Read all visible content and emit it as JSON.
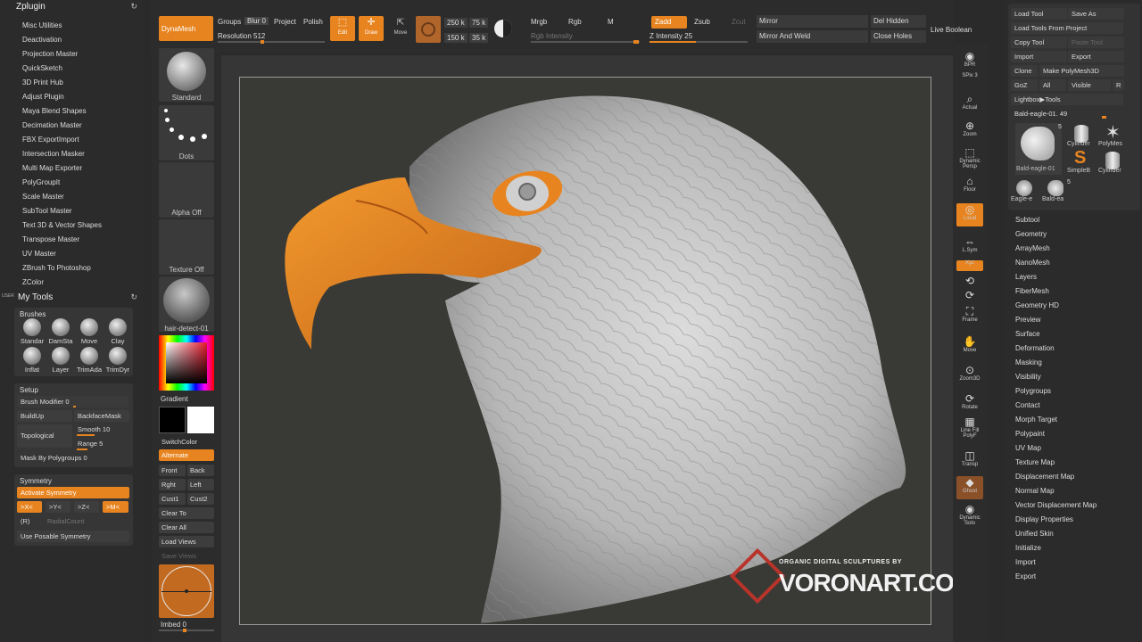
{
  "zplugin": {
    "title": "Zplugin",
    "items": [
      "Misc Utilities",
      "Deactivation",
      "Projection Master",
      "QuickSketch",
      "3D Print Hub",
      "Adjust Plugin",
      "Maya Blend Shapes",
      "Decimation Master",
      "FBX ExportImport",
      "Intersection Masker",
      "Multi Map Exporter",
      "PolyGroupIt",
      "Scale Master",
      "SubTool Master",
      "Text 3D & Vector Shapes",
      "Transpose Master",
      "UV Master",
      "ZBrush To Photoshop",
      "ZColor"
    ]
  },
  "mytools": {
    "user_tag": "USER",
    "title": "My Tools",
    "brushes_title": "Brushes",
    "brushes": [
      "Standar",
      "DamSta",
      "Move",
      "Clay",
      "Inflat",
      "Layer",
      "TrimAda",
      "TrimDyr"
    ],
    "setup_title": "Setup",
    "brush_modifier": "Brush Modifier 0",
    "buildup": "BuildUp",
    "backface": "BackfaceMask",
    "topological": "Topological",
    "smooth": "Smooth 10",
    "range": "Range 5",
    "mask_polygroups": "Mask By Polygroups 0",
    "symmetry_title": "Symmetry",
    "activate_symmetry": "Activate Symmetry",
    "axes": [
      ">X<",
      ">Y<",
      ">Z<",
      ">M<"
    ],
    "r_label": "(R)",
    "radial_count": "RadialCount",
    "posable": "Use Posable Symmetry"
  },
  "top": {
    "dynamesh": "DynaMesh",
    "groups": "Groups",
    "blur": "Blur 0",
    "project": "Project",
    "polish": "Polish",
    "resolution": "Resolution 512",
    "edit": "Edit",
    "draw": "Draw",
    "move": "Move",
    "counts": [
      "250 k",
      "75 k",
      "150 k",
      "35 k"
    ],
    "mrgb": "Mrgb",
    "rgb": "Rgb",
    "m": "M",
    "rgb_intensity": "Rgb Intensity",
    "zadd": "Zadd",
    "zsub": "Zsub",
    "zcut": "Zcut",
    "z_intensity": "Z Intensity 25",
    "mirror": "Mirror",
    "mirror_weld": "Mirror And Weld",
    "del_hidden": "Del Hidden",
    "close_holes": "Close Holes",
    "live_boolean": "Live Boolean"
  },
  "shelf": {
    "standard": "Standard",
    "dots": "Dots",
    "alpha_off": "Alpha Off",
    "texture_off": "Texture Off",
    "material": "hair-detect-01",
    "gradient": "Gradient",
    "switch_color": "SwitchColor",
    "alternate": "Alternate",
    "front": "Front",
    "back": "Back",
    "rght": "Rght",
    "left": "Left",
    "cust1": "Cust1",
    "cust2": "Cust2",
    "clear_to": "Clear To",
    "clear_all": "Clear All",
    "load_views": "Load Views",
    "save_views": "Save Views",
    "imbed": "Imbed 0"
  },
  "canvas": {
    "logo_tagline": "ORGANIC DIGITAL SCULPTURES BY",
    "logo_name": "VORONART.COM"
  },
  "rshelf": [
    "BPR",
    "SPix 3",
    "Actual",
    "Zoom",
    "Dynamic Persp",
    "Floor",
    "Local",
    "L.Sym",
    "Xyz",
    "",
    "",
    "Frame",
    "Move",
    "Zoom3D",
    "Rotate",
    "Line Fill PolyF",
    "Transp",
    "Ghost",
    "Dynamic Solo"
  ],
  "tool": {
    "load_tool": "Load Tool",
    "save_as": "Save As",
    "load_from_project": "Load Tools From Project",
    "copy_tool": "Copy Tool",
    "paste_tool": "Paste Tool",
    "import": "Import",
    "export": "Export",
    "clone": "Clone",
    "make_polymesh": "Make PolyMesh3D",
    "goz": "GoZ",
    "all": "All",
    "visible": "Visible",
    "r": "R",
    "lightbox": "Lightbox▶Tools",
    "current_tool": "Bald-eagle-01. 49",
    "thumbs": [
      "Bald-eagle-01",
      "Cylinder",
      "PolyMes",
      "SimpleB",
      "Cylinder",
      "Eagle-e",
      "Bald-ea"
    ],
    "thumb_count": "5",
    "subpanels": [
      "Subtool",
      "Geometry",
      "ArrayMesh",
      "NanoMesh",
      "Layers",
      "FiberMesh",
      "Geometry HD",
      "Preview",
      "Surface",
      "Deformation",
      "Masking",
      "Visibility",
      "Polygroups",
      "Contact",
      "Morph Target",
      "Polypaint",
      "UV Map",
      "Texture Map",
      "Displacement Map",
      "Normal Map",
      "Vector Displacement Map",
      "Display Properties",
      "Unified Skin",
      "Initialize",
      "Import",
      "Export"
    ]
  },
  "colors": {
    "accent": "#e8841f",
    "panel": "#2b2b2b",
    "canvas": "#393935"
  }
}
